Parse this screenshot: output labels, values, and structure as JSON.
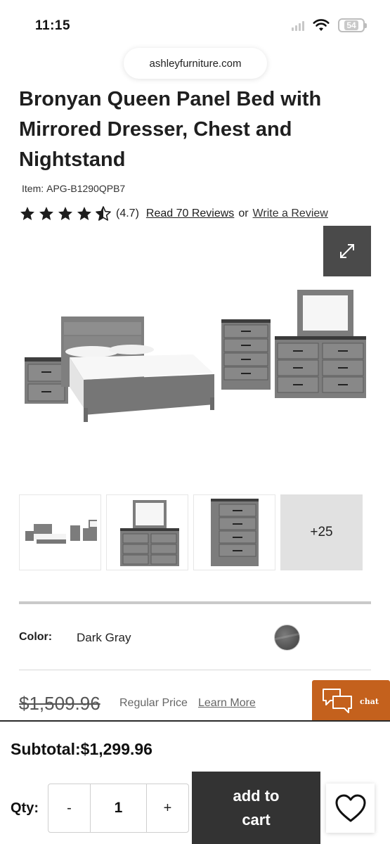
{
  "status_bar": {
    "time": "11:15",
    "battery": "54",
    "icons": [
      "signal-icon",
      "wifi-icon",
      "battery-icon"
    ]
  },
  "browser": {
    "url": "ashleyfurniture.com"
  },
  "product": {
    "title": "Bronyan Queen Panel Bed with Mirrored Dresser, Chest and Nightstand",
    "item_label": "Item:",
    "item_number": "APG-B1290QPB7",
    "rating": "(4.7)",
    "stars": 4.5,
    "reviews_link": "Read 70 Reviews",
    "or_text": "or",
    "write_review": "Write a Review"
  },
  "gallery": {
    "expand_icon": "expand-icon",
    "more_count": "+25",
    "thumbnails": [
      "bedroom-set",
      "dresser-mirror",
      "chest"
    ]
  },
  "color": {
    "label": "Color:",
    "value": "Dark Gray",
    "swatch": "#5f5f5f"
  },
  "price": {
    "regular": "$1,509.96",
    "regular_label": "Regular Price",
    "learn_more": "Learn More"
  },
  "chat": {
    "label": "chat",
    "color": "#c4611d"
  },
  "cart": {
    "subtotal": "Subtotal:$1,299.96",
    "qty_label": "Qty:",
    "minus": "-",
    "qty": "1",
    "plus": "+",
    "add_to_cart": "add to cart"
  },
  "colors": {
    "accent": "#c4611d",
    "button_dark": "#333333",
    "expand_bg": "#4a4a4a"
  }
}
